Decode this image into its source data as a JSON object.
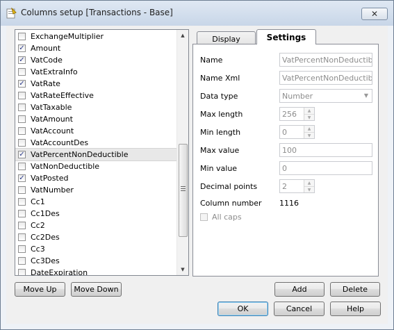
{
  "window": {
    "title": "Columns setup [Transactions - Base]",
    "close_glyph": "✕"
  },
  "columns": [
    {
      "name": "ExchangeMultiplier",
      "checked": false
    },
    {
      "name": "Amount",
      "checked": true
    },
    {
      "name": "VatCode",
      "checked": true
    },
    {
      "name": "VatExtraInfo",
      "checked": false
    },
    {
      "name": "VatRate",
      "checked": true
    },
    {
      "name": "VatRateEffective",
      "checked": false
    },
    {
      "name": "VatTaxable",
      "checked": false
    },
    {
      "name": "VatAmount",
      "checked": false
    },
    {
      "name": "VatAccount",
      "checked": false
    },
    {
      "name": "VatAccountDes",
      "checked": false
    },
    {
      "name": "VatPercentNonDeductible",
      "checked": true,
      "selected": true
    },
    {
      "name": "VatNonDeductible",
      "checked": false
    },
    {
      "name": "VatPosted",
      "checked": true
    },
    {
      "name": "VatNumber",
      "checked": false
    },
    {
      "name": "Cc1",
      "checked": false
    },
    {
      "name": "Cc1Des",
      "checked": false
    },
    {
      "name": "Cc2",
      "checked": false
    },
    {
      "name": "Cc2Des",
      "checked": false
    },
    {
      "name": "Cc3",
      "checked": false
    },
    {
      "name": "Cc3Des",
      "checked": false
    },
    {
      "name": "DateExpiration",
      "checked": false
    }
  ],
  "tabs": {
    "display": "Display",
    "settings": "Settings",
    "active": "Settings"
  },
  "settings": {
    "name_label": "Name",
    "name_value": "VatPercentNonDeductible",
    "name_xml_label": "Name Xml",
    "name_xml_value": "VatPercentNonDeductible",
    "data_type_label": "Data type",
    "data_type_value": "Number",
    "max_length_label": "Max length",
    "max_length_value": "256",
    "min_length_label": "Min length",
    "min_length_value": "0",
    "max_value_label": "Max value",
    "max_value_value": "100",
    "min_value_label": "Min value",
    "min_value_value": "0",
    "decimal_points_label": "Decimal points",
    "decimal_points_value": "2",
    "column_number_label": "Column number",
    "column_number_value": "1116",
    "all_caps_label": "All caps",
    "all_caps_checked": false
  },
  "buttons": {
    "move_up": "Move Up",
    "move_down": "Move Down",
    "add": "Add",
    "delete": "Delete",
    "ok": "OK",
    "cancel": "Cancel",
    "help": "Help"
  }
}
